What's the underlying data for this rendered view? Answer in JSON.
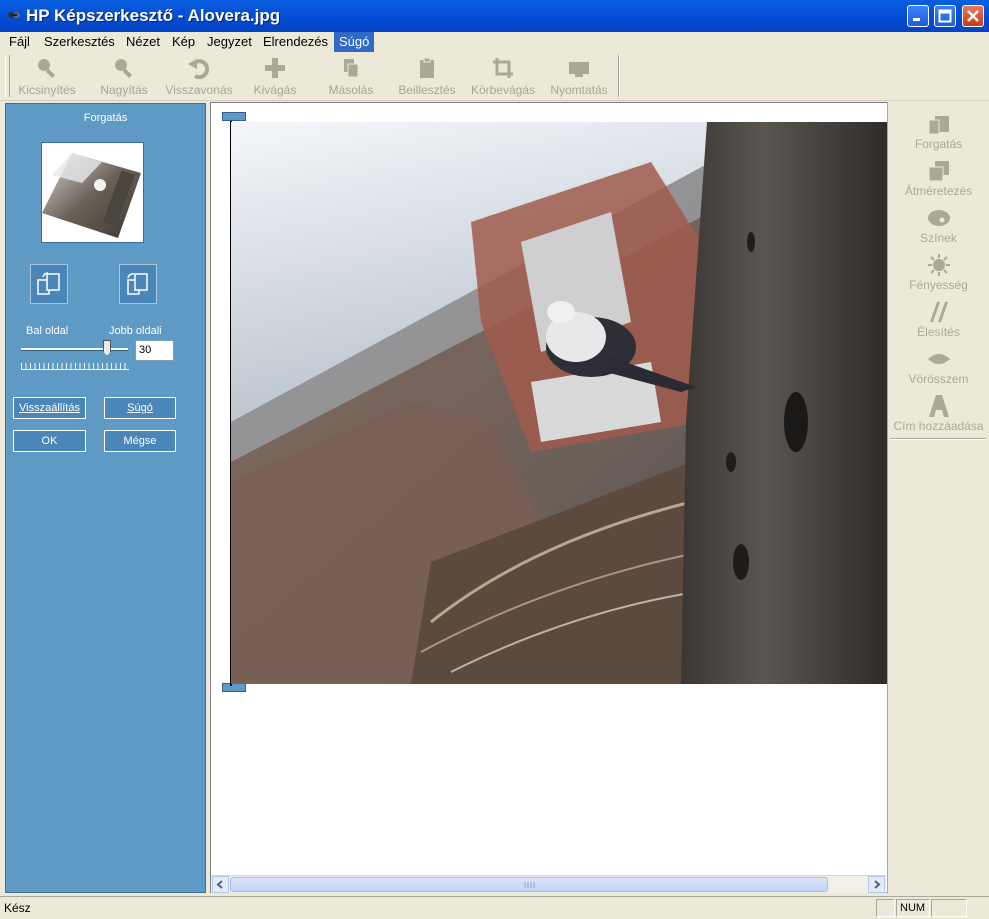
{
  "window": {
    "title": "HP Képszerkesztő - Alovera.jpg"
  },
  "menu": [
    "Fájl",
    "Szerkesztés",
    "Nézet",
    "Kép",
    "Jegyzet",
    "Elrendezés",
    "Súgó"
  ],
  "toolbar": {
    "zoom_out": "Kicsinyítés",
    "zoom_in": "Nagyítás",
    "undo": "Visszavonás",
    "cut": "Kivágás",
    "copy": "Másolás",
    "paste": "Beillesztés",
    "crop": "Körbevágás",
    "print": "Nyomtatás"
  },
  "rotate_panel": {
    "title": "Forgatás",
    "left_label": "Bal oldal",
    "right_label": "Jobb oldali",
    "angle_value": "30",
    "slider_fraction": 0.87,
    "reset_label": "Visszaállítás",
    "help_label": "Súgó",
    "ok_label": "OK",
    "cancel_label": "Mégse"
  },
  "tools": [
    "Forgatás",
    "Átméretezés",
    "Színek",
    "Fényesség",
    "Élesítés",
    "Vörösszem",
    "Cím hozzáadása"
  ],
  "status": {
    "text": "Kész",
    "num": "NUM"
  },
  "colors": {
    "panel_blue": "#5f9ac4",
    "title_blue": "#0550d8",
    "menu_highlight": "#316ac5"
  }
}
